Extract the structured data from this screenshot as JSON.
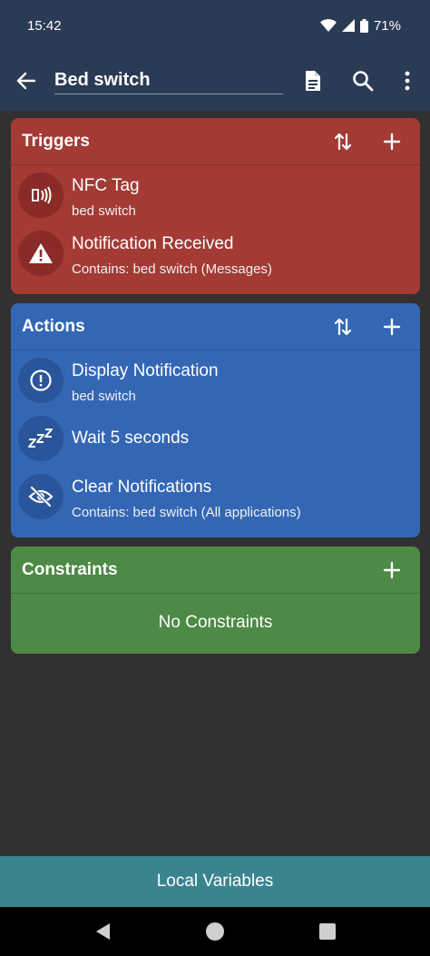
{
  "status": {
    "time": "15:42",
    "battery": "71%"
  },
  "appbar": {
    "title": "Bed switch"
  },
  "triggers": {
    "header": "Triggers",
    "items": [
      {
        "title": "NFC Tag",
        "subtitle": "bed switch",
        "icon": "nfc-icon"
      },
      {
        "title": "Notification Received",
        "subtitle": "Contains: bed switch (Messages)",
        "icon": "warning-icon"
      }
    ]
  },
  "actions": {
    "header": "Actions",
    "items": [
      {
        "title": "Display Notification",
        "subtitle": "bed switch",
        "icon": "alert-circle-icon"
      },
      {
        "title": "Wait 5 seconds",
        "subtitle": "",
        "icon": "sleep-zzz-icon"
      },
      {
        "title": "Clear Notifications",
        "subtitle": "Contains: bed switch (All applications)",
        "icon": "eye-off-icon"
      }
    ]
  },
  "constraints": {
    "header": "Constraints",
    "empty": "No Constraints"
  },
  "footer": {
    "local_variables": "Local Variables"
  },
  "colors": {
    "bar": "#2b3a55",
    "background": "#313131",
    "triggers": "#a33a34",
    "actions": "#3367b4",
    "constraints": "#4c8a45",
    "local_variables": "#3a8490"
  }
}
